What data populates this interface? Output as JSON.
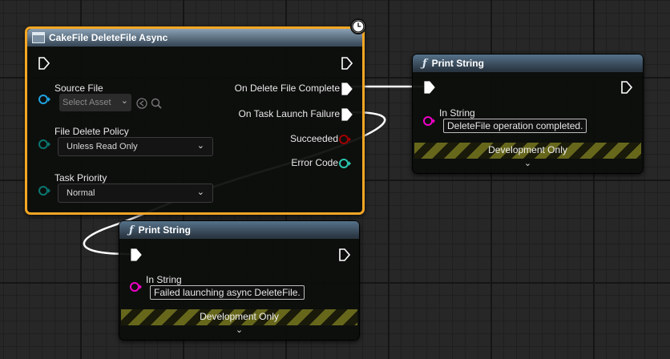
{
  "async_node": {
    "title": "CakeFile DeleteFile Async",
    "inputs": {
      "source_file_label": "Source File",
      "source_file_value": "Select Asset",
      "delete_policy_label": "File Delete Policy",
      "delete_policy_value": "Unless Read Only",
      "task_priority_label": "Task Priority",
      "task_priority_value": "Normal"
    },
    "outputs": {
      "on_complete": "On Delete File Complete",
      "on_launch_failure": "On Task Launch Failure",
      "succeeded": "Succeeded",
      "error_code": "Error Code"
    }
  },
  "print_node_top": {
    "title": "Print String",
    "in_string_label": "In String",
    "in_string_value": "DeleteFile operation completed.",
    "dev_only": "Development Only"
  },
  "print_node_bottom": {
    "title": "Print String",
    "in_string_label": "In String",
    "in_string_value": "Failed launching async DeleteFile.",
    "dev_only": "Development Only"
  },
  "colors": {
    "selected_border": "#f5a623",
    "exec_pin": "#ffffff",
    "object_pin": "#1fa3e0",
    "enum_pin": "#0a7770",
    "bool_pin": "#a00000",
    "string_pin": "#f000c8",
    "int_pin": "#2ac7b0"
  },
  "icons": {
    "function": "function-icon",
    "async": "async-node-icon",
    "latent": "clock-icon"
  }
}
